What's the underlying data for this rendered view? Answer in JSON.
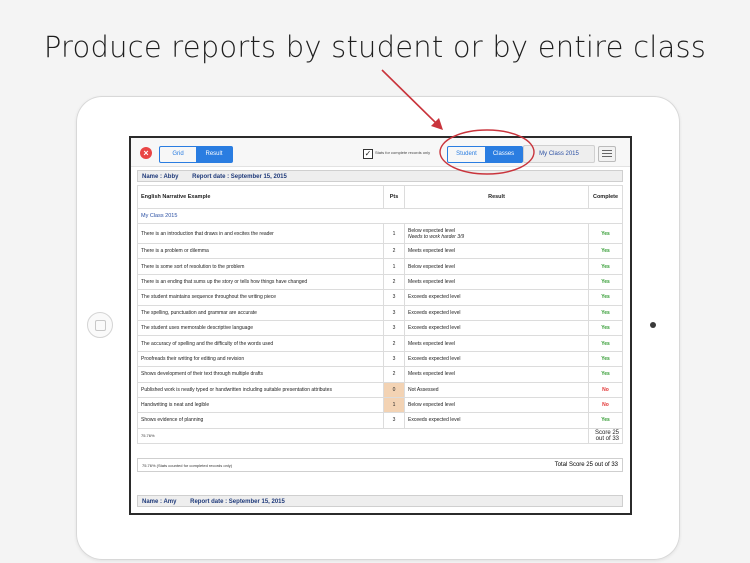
{
  "caption": "Produce reports by student or by entire class",
  "toolbar": {
    "close_icon": "×",
    "view_tabs": [
      {
        "label": "Grid",
        "selected": false
      },
      {
        "label": "Result",
        "selected": true
      }
    ],
    "stats_checkbox_mark": "✓",
    "stats_checkbox_label": "Stats for complete records only",
    "scope_tabs": [
      {
        "label": "Student",
        "selected": false
      },
      {
        "label": "Classes",
        "selected": true
      }
    ],
    "class_selector": "My Class 2015"
  },
  "report1": {
    "name_label": "Name : Abby",
    "date_label": "Report date : September 15, 2015",
    "headers": {
      "criterion": "English Narrative Example",
      "pts": "Pts",
      "result": "Result",
      "complete": "Complete"
    },
    "group": "My Class 2015",
    "rows": [
      {
        "criterion": "There is an introduction that draws in and excites the reader",
        "pts": "1",
        "result": "Below expected level",
        "note": "Needs to work harder 3/9",
        "complete": "Yes"
      },
      {
        "criterion": "There is a problem or dilemma",
        "pts": "2",
        "result": "Meets expected level",
        "complete": "Yes"
      },
      {
        "criterion": "There is some sort of resolution to the problem",
        "pts": "1",
        "result": "Below expected level",
        "complete": "Yes"
      },
      {
        "criterion": "There is an ending that sums up the story or tells how things have changed",
        "pts": "2",
        "result": "Meets expected level",
        "complete": "Yes"
      },
      {
        "criterion": "The student maintains sequence throughout the writing piece",
        "pts": "3",
        "result": "Exceeds expected level",
        "complete": "Yes"
      },
      {
        "criterion": "The spelling, punctuation and grammar are accurate",
        "pts": "3",
        "result": "Exceeds expected level",
        "complete": "Yes"
      },
      {
        "criterion": "The student uses memorable descriptive language",
        "pts": "3",
        "result": "Exceeds expected level",
        "complete": "Yes"
      },
      {
        "criterion": "The accuracy of spelling and the difficulty of the words used",
        "pts": "2",
        "result": "Meets expected level",
        "complete": "Yes"
      },
      {
        "criterion": "Proofreads their writing for editing and revision",
        "pts": "3",
        "result": "Exceeds expected level",
        "complete": "Yes"
      },
      {
        "criterion": "Shows development of their text through multiple drafts",
        "pts": "2",
        "result": "Meets expected level",
        "complete": "Yes"
      },
      {
        "criterion": "Published work is neatly typed or handwritten including suitable presentation attributes",
        "pts": "0",
        "result": "Not Assessed",
        "complete": "No"
      },
      {
        "criterion": "Handwriting is neat and legible",
        "pts": "1",
        "result": "Below expected level",
        "complete": "No"
      },
      {
        "criterion": "Shows evidence of planning",
        "pts": "3",
        "result": "Exceeds expected level",
        "complete": "Yes"
      }
    ],
    "percent": "75.76%",
    "score": "Score 25 out of 33",
    "stats_note": "75.76% (Stats counted for completed records only)",
    "total_score": "Total Score 25 out of 33"
  },
  "report2": {
    "name_label": "Name : Amy",
    "date_label": "Report date : September 15, 2015"
  },
  "colors": {
    "accent": "#2a7de1",
    "annotation": "#c9343c",
    "yes": "#2f9a2f",
    "no": "#e23434",
    "warn_cell": "#f3d3b4"
  }
}
